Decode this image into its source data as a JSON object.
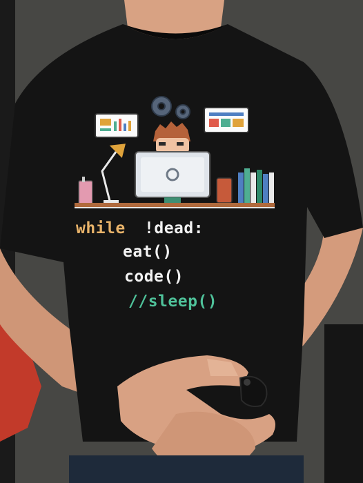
{
  "scene": {
    "subject": "person-wearing-black-tshirt",
    "shirt_print": {
      "line1_keyword": "while",
      "line1_rest": "!dead:",
      "line2": "eat()",
      "line3": "code()",
      "line4": "//sleep()"
    },
    "colors": {
      "shirt": "#141414",
      "skin": "#d9a385",
      "keyword": "#e8b36a",
      "code_text": "#f2f2f2",
      "comment": "#4fc29a",
      "wall": "#4a4a47"
    },
    "icons": [
      "gear-icon",
      "monitor-icon",
      "desk-lamp-icon",
      "books-icon",
      "mug-icon",
      "dashboard-icon",
      "wristband-icon"
    ]
  }
}
